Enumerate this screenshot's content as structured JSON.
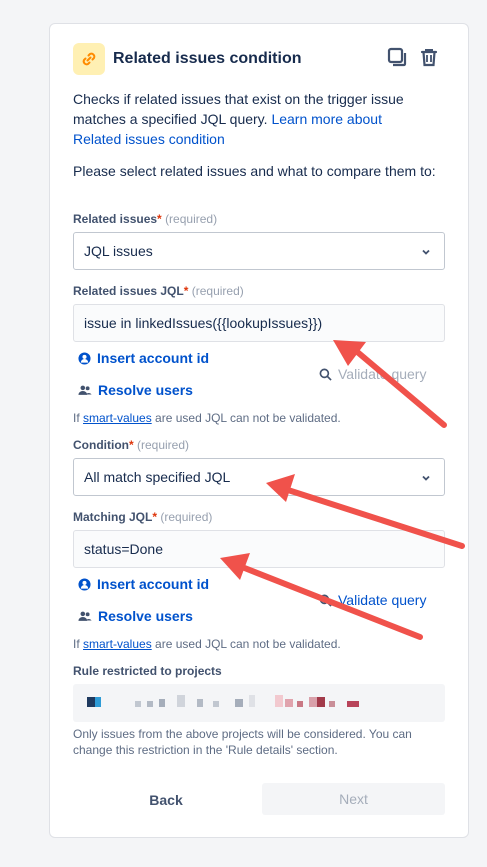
{
  "header": {
    "title": "Related issues condition",
    "icon": "link-icon",
    "copy_icon": "copy-icon",
    "delete_icon": "trash-icon"
  },
  "description": {
    "text": "Checks if related issues that exist on the trigger issue matches a specified JQL query.",
    "link": "Learn more about Related issues condition"
  },
  "instruction": "Please select related issues and what to compare them to:",
  "related_issues": {
    "label": "Related issues",
    "required": "(required)",
    "value": "JQL issues"
  },
  "related_jql": {
    "label": "Related issues JQL",
    "required": "(required)",
    "value": "issue in linkedIssues({{lookupIssues}})",
    "insert_account": "Insert account id",
    "resolve_users": "Resolve users",
    "validate": "Validate query",
    "note_prefix": "If ",
    "note_link": "smart-values",
    "note_suffix": " are used JQL can not be validated."
  },
  "condition": {
    "label": "Condition",
    "required": "(required)",
    "value": "All match specified JQL"
  },
  "matching_jql": {
    "label": "Matching JQL",
    "required": "(required)",
    "value": "status=Done",
    "insert_account": "Insert account id",
    "resolve_users": "Resolve users",
    "validate": "Validate query",
    "note_prefix": "If ",
    "note_link": "smart-values",
    "note_suffix": " are used JQL can not be validated."
  },
  "projects": {
    "label": "Rule restricted to projects",
    "help": "Only issues from the above projects will be considered. You can change this restriction in the 'Rule details' section."
  },
  "footer": {
    "back": "Back",
    "next": "Next"
  },
  "colors": {
    "link": "#0052cc",
    "required_star": "#de350b",
    "annotation_arrow": "#f0524b"
  }
}
